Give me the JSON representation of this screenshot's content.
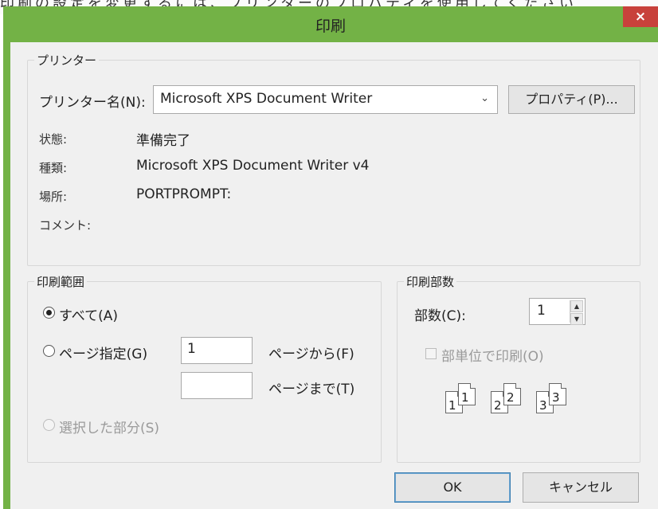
{
  "background_text": "印刷の設定を変更するには、プリンターのプロパティを使用してください",
  "window": {
    "title": "印刷",
    "close_glyph": "×"
  },
  "printer": {
    "group_label": "プリンター",
    "name_label": "プリンター名(N):",
    "name_value": "Microsoft XPS Document Writer",
    "dropdown_glyph": "⌄",
    "properties_button": "プロパティ(P)...",
    "status_label": "状態:",
    "status_value": "準備完了",
    "type_label": "種類:",
    "type_value": "Microsoft XPS Document Writer v4",
    "location_label": "場所:",
    "location_value": "PORTPROMPT:",
    "comment_label": "コメント:",
    "comment_value": ""
  },
  "range": {
    "group_label": "印刷範囲",
    "all_label": "すべて(A)",
    "pages_label": "ページ指定(G)",
    "from_value": "1",
    "from_label": "ページから(F)",
    "to_value": "",
    "to_label": "ページまで(T)",
    "selection_label": "選択した部分(S)",
    "selected": "all"
  },
  "copies": {
    "group_label": "印刷部数",
    "count_label": "部数(C):",
    "count_value": "1",
    "spin_up": "▲",
    "spin_down": "▼",
    "collate_label": "部単位で印刷(O)",
    "collate_checked": false,
    "collate_pages": [
      "1",
      "1",
      "2",
      "2",
      "3",
      "3"
    ]
  },
  "buttons": {
    "ok": "OK",
    "cancel": "キャンセル"
  },
  "colors": {
    "title_bar": "#73b246",
    "close_button": "#c8413b",
    "dialog_body": "#f0f0f0"
  }
}
